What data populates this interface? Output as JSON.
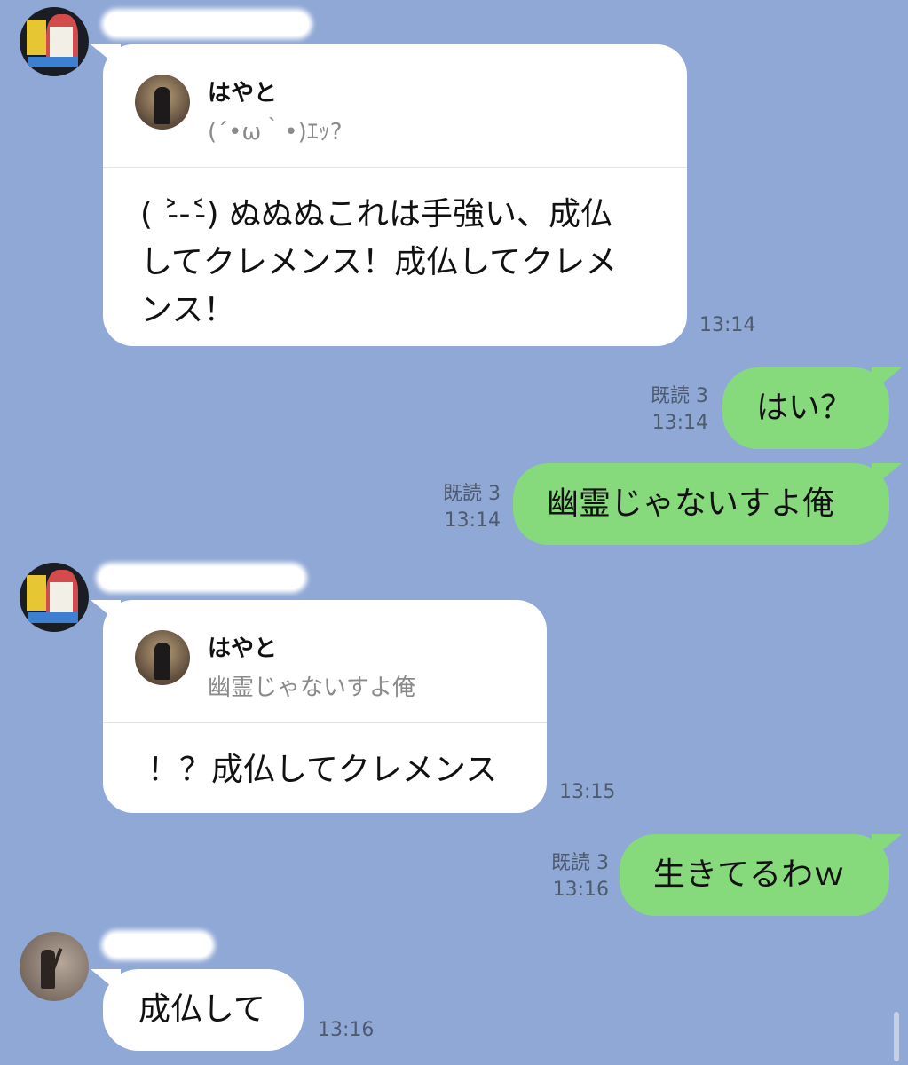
{
  "messages": [
    {
      "reply_name": "はやと",
      "reply_text": "(´•ω｀•)ｴｯ?",
      "body": "( ˃̵-˂̵) ぬぬぬこれは手強い、成仏\nしてクレメンス！成仏してクレメ\nンス！",
      "time": "13:14"
    },
    {
      "read": "既読 3",
      "time": "13:14",
      "body": "はい？"
    },
    {
      "read": "既読 3",
      "time": "13:14",
      "body": "幽霊じゃないすよ俺"
    },
    {
      "reply_name": "はやと",
      "reply_text": "幽霊じゃないすよ俺",
      "body": "！？成仏してクレメンス",
      "time": "13:15"
    },
    {
      "read": "既読 3",
      "time": "13:16",
      "body": "生きてるわｗ"
    },
    {
      "body": "成仏して",
      "time": "13:16"
    }
  ]
}
